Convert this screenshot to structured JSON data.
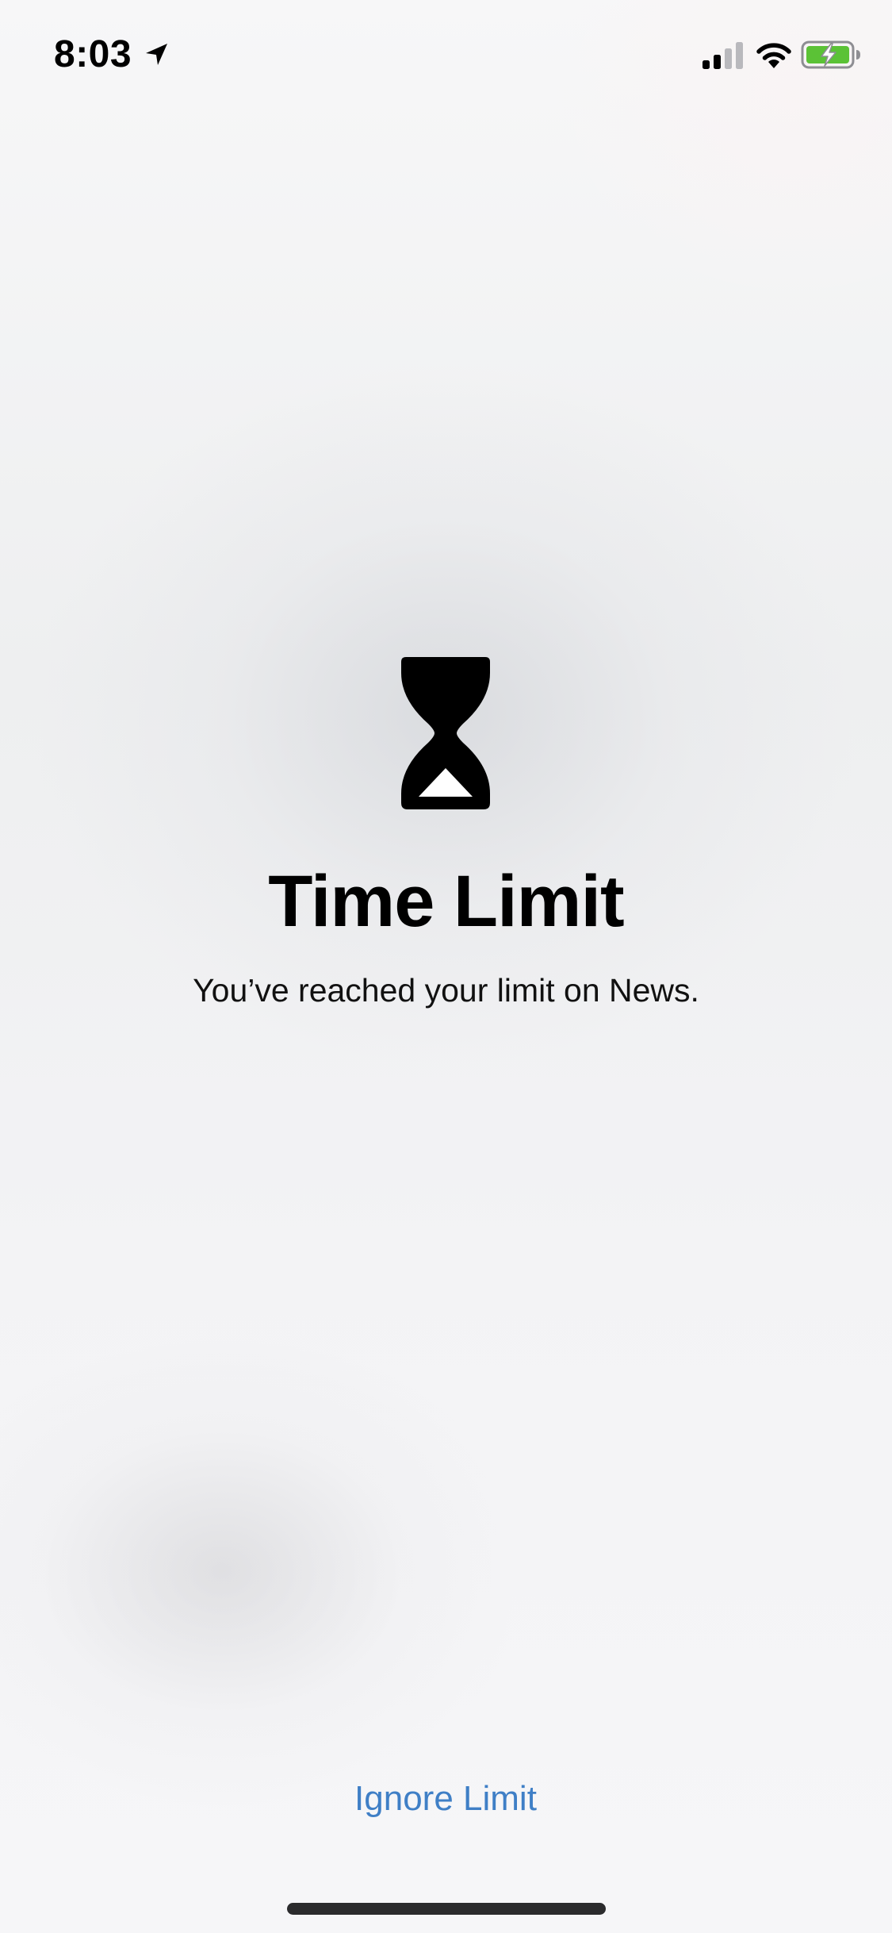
{
  "status_bar": {
    "time": "8:03",
    "icons": [
      "location-arrow-icon",
      "cellular-signal-icon",
      "wifi-icon",
      "battery-charging-icon"
    ],
    "battery_color": "#5bc236"
  },
  "screen_time": {
    "icon": "hourglass-icon",
    "title": "Time Limit",
    "message": "You’ve reached your limit on News."
  },
  "actions": {
    "ignore_limit_label": "Ignore Limit",
    "link_color": "#3f7fc6"
  }
}
